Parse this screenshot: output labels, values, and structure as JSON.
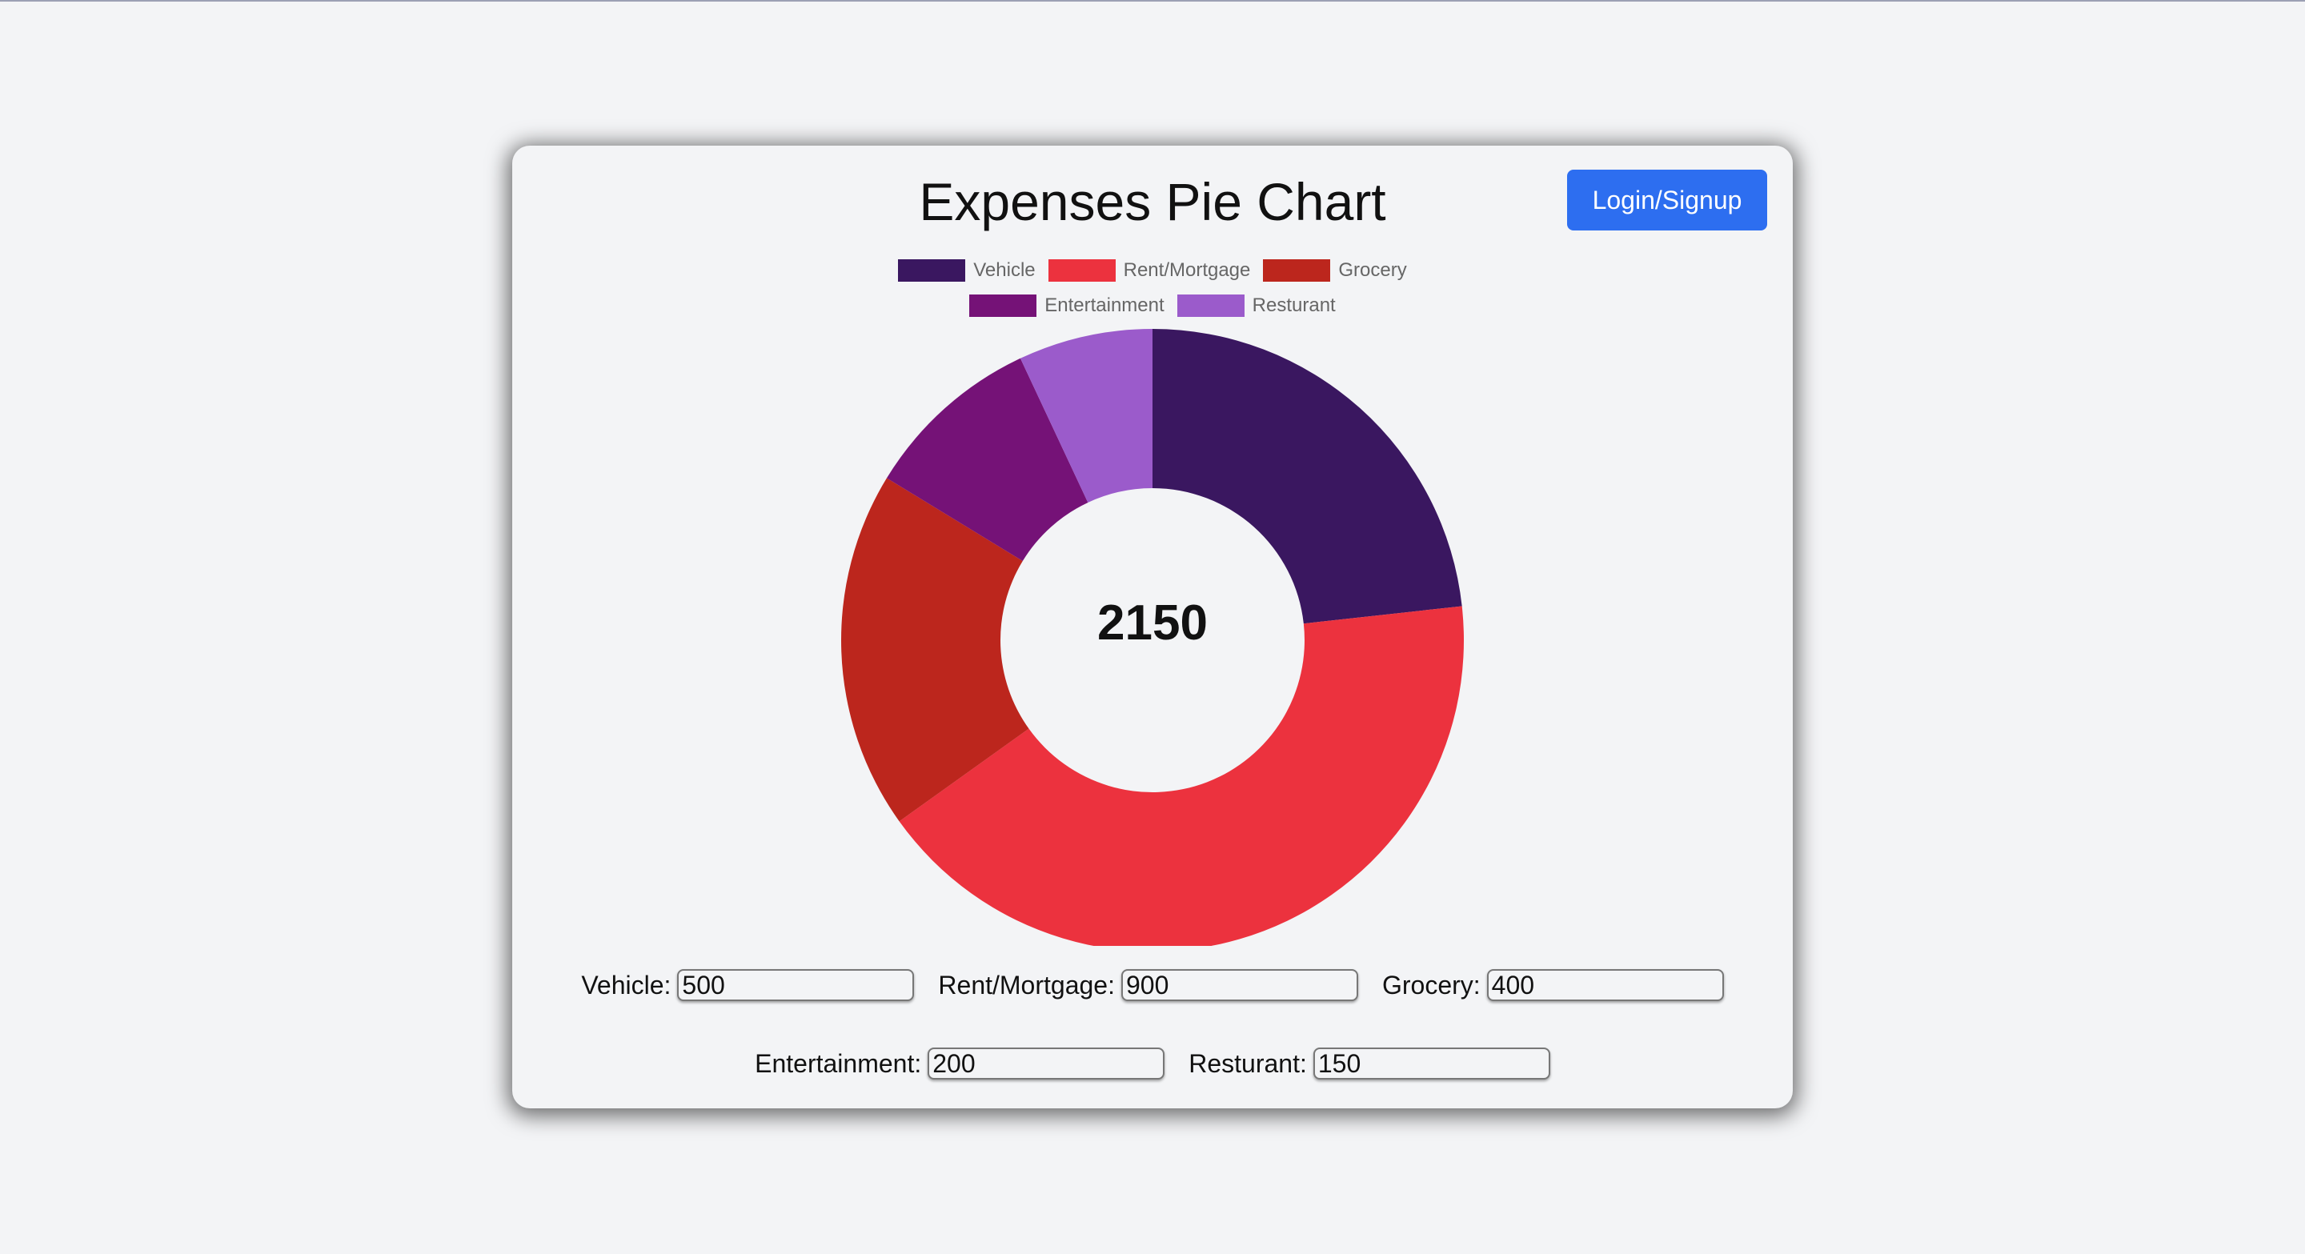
{
  "header": {
    "title": "Expenses Pie Chart",
    "login_label": "Login/Signup"
  },
  "colors": {
    "accent": "#2d6ef0",
    "background": "#f3f4f6"
  },
  "chart_data": {
    "type": "pie",
    "title": "Expenses Pie Chart",
    "categories": [
      "Vehicle",
      "Rent/Mortgage",
      "Grocery",
      "Entertainment",
      "Resturant"
    ],
    "values": [
      500,
      900,
      400,
      200,
      150
    ],
    "colors": [
      "#3a1760",
      "#ec323e",
      "#bc261d",
      "#751277",
      "#9b5bcb"
    ],
    "center_label": "2150",
    "donut": true,
    "legend_position": "top"
  },
  "form": {
    "fields": [
      {
        "label": "Vehicle:",
        "value": "500"
      },
      {
        "label": "Rent/Mortgage:",
        "value": "900"
      },
      {
        "label": "Grocery:",
        "value": "400"
      },
      {
        "label": "Entertainment:",
        "value": "200"
      },
      {
        "label": "Resturant:",
        "value": "150"
      }
    ]
  }
}
